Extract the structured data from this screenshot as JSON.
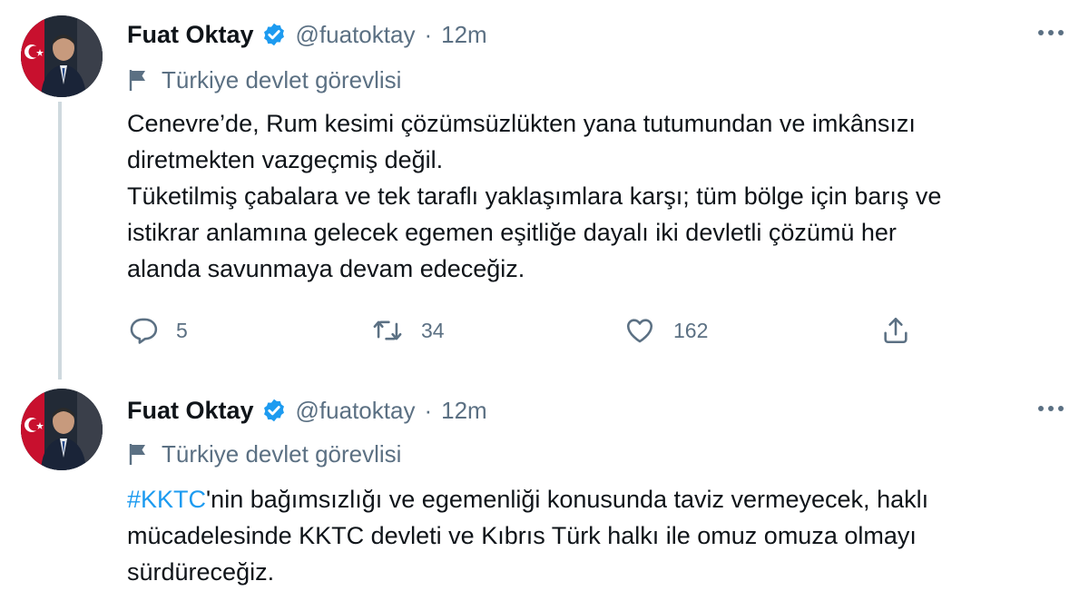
{
  "tweets": [
    {
      "author": {
        "name": "Fuat Oktay",
        "handle": "@fuatoktay",
        "time": "12m"
      },
      "label": "Türkiye devlet görevlisi",
      "lines": [
        "Cenevre’de, Rum kesimi çözümsüzlükten yana tutumundan ve imkânsızı",
        "diretmekten vazgeçmiş değil.",
        "Tüketilmiş çabalara ve tek taraflı yaklaşımlara karşı; tüm bölge için barış ve",
        "istikrar anlamına gelecek egemen eşitliğe dayalı iki devletli çözümü her",
        "alanda savunmaya devam edeceğiz."
      ],
      "actions": {
        "replies": "5",
        "retweets": "34",
        "likes": "162"
      }
    },
    {
      "author": {
        "name": "Fuat Oktay",
        "handle": "@fuatoktay",
        "time": "12m"
      },
      "label": "Türkiye devlet görevlisi",
      "hashtag": "#KKTC",
      "lines": [
        "'nin bağımsızlığı ve egemenliği konusunda taviz vermeyecek, haklı",
        "mücadelesinde KKTC devleti ve Kıbrıs Türk halkı ile omuz omuza olmayı",
        "sürdüreceğiz."
      ]
    }
  ],
  "separator": "·",
  "colors": {
    "accent": "#1d9bf0",
    "secondary_text": "#5b7083",
    "thread_line": "#cfd9de"
  },
  "icons": [
    "verified-badge-icon",
    "flag-icon",
    "reply-icon",
    "retweet-icon",
    "like-icon",
    "share-icon",
    "more-options-icon"
  ]
}
